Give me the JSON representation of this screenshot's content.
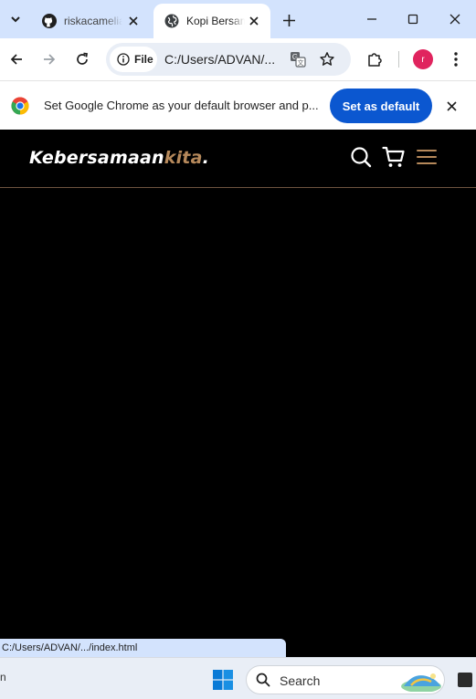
{
  "tabs": [
    {
      "title": "riskacamelia",
      "icon": "github-icon",
      "active": false
    },
    {
      "title": "Kopi Bersama",
      "icon": "globe-icon",
      "active": true
    }
  ],
  "toolbar": {
    "site_chip_label": "File",
    "url": "C:/Users/ADVAN/..."
  },
  "profile": {
    "initial": "r",
    "color": "#e0245e"
  },
  "infobar": {
    "message": "Set Google Chrome as your default browser and p...",
    "button_label": "Set as default"
  },
  "site": {
    "logo_main": "Kebersamaan",
    "logo_accent": "kita",
    "logo_dot": ".",
    "accent_color": "#b6895b"
  },
  "status_url": "C:/Users/ADVAN/.../index.html",
  "taskbar": {
    "edge_text": "n",
    "search_label": "Search"
  },
  "colors": {
    "tabstrip": "#d3e3fd",
    "button_blue": "#0b57d0",
    "page_bg": "#000000"
  }
}
